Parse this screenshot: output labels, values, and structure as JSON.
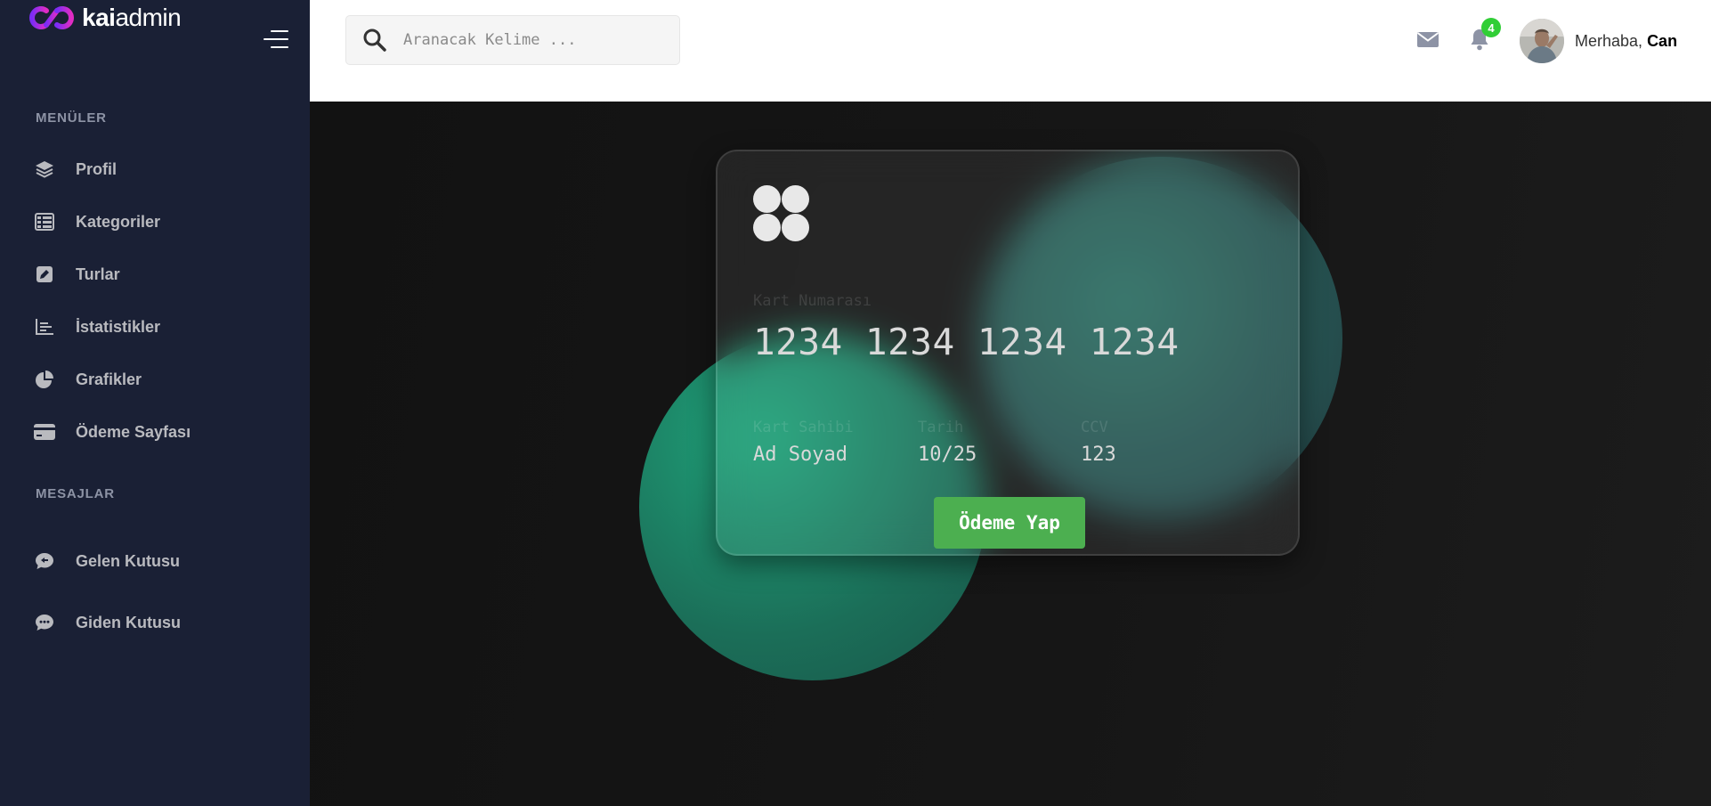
{
  "brand": {
    "name_bold": "kai",
    "name_rest": "admin"
  },
  "sidebar": {
    "section_menus": "MENÜLER",
    "menu_items": [
      {
        "label": "Profil",
        "icon": "layers-icon"
      },
      {
        "label": "Kategoriler",
        "icon": "table-icon"
      },
      {
        "label": "Turlar",
        "icon": "edit-icon"
      },
      {
        "label": "İstatistikler",
        "icon": "chart-icon"
      },
      {
        "label": "Grafikler",
        "icon": "pie-icon"
      },
      {
        "label": "Ödeme Sayfası",
        "icon": "credit-card-icon"
      }
    ],
    "section_messages": "MESAJLAR",
    "message_items": [
      {
        "label": "Gelen Kutusu",
        "icon": "comment-dots-icon"
      },
      {
        "label": "Giden Kutusu",
        "icon": "comment-icon"
      }
    ]
  },
  "header": {
    "search_placeholder": "Aranacak Kelime ...",
    "notification_count": "4",
    "greeting_prefix": "Merhaba,",
    "user_name": "Can"
  },
  "card": {
    "number_label": "Kart Numarası",
    "number_value": "1234 1234 1234 1234",
    "holder_label": "Kart Sahibi",
    "holder_value": "Ad Soyad",
    "date_label": "Tarih",
    "date_value": "10/25",
    "cvv_label": "CCV",
    "cvv_value": "123",
    "pay_button": "Ödeme Yap"
  },
  "colors": {
    "sidebar_bg": "#1a2035",
    "brand_accent": "#a72cff",
    "badge": "#31ce36",
    "pay_button": "#4caf50"
  }
}
